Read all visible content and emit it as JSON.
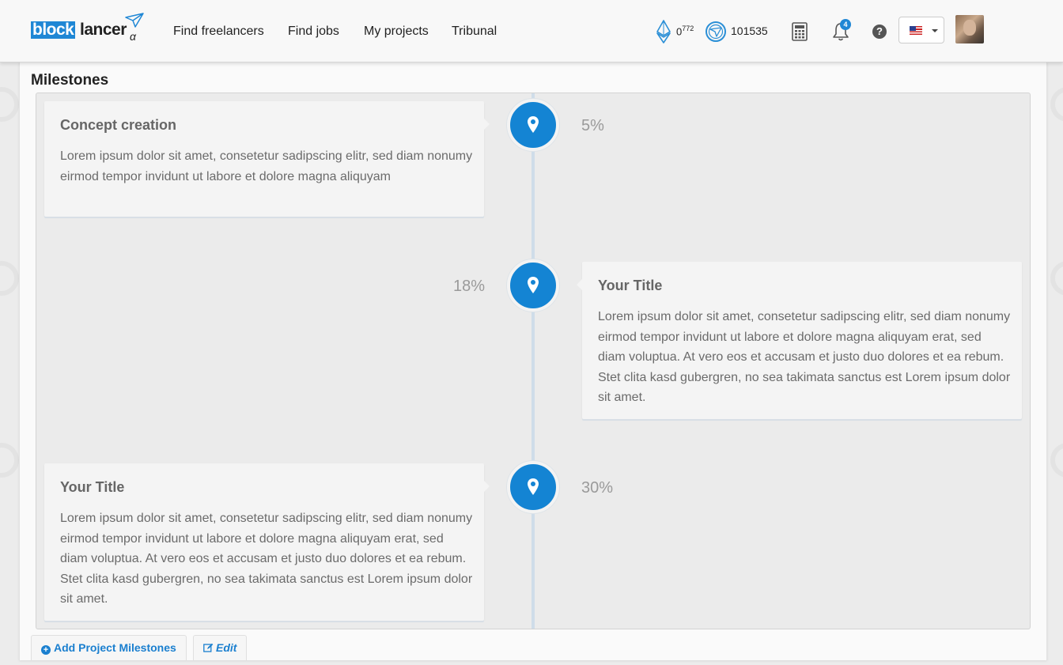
{
  "brand": {
    "name_block": "block",
    "name_lancer": "lancer",
    "suffix": "α",
    "accent_color": "#1f87d5"
  },
  "nav": {
    "links": [
      "Find freelancers",
      "Find jobs",
      "My projects",
      "Tribunal"
    ]
  },
  "wallet": {
    "eth_icon": "ethereum-icon",
    "eth_balance": "0",
    "eth_exponent": "772",
    "token_icon": "blocklancer-token-icon",
    "token_balance": "101535"
  },
  "toolbar": {
    "calculator_icon": "calculator-icon",
    "notifications_icon": "bell-icon",
    "notification_count": "4",
    "help_glyph": "?",
    "language": "en-US"
  },
  "page": {
    "section_title": "Milestones"
  },
  "milestones": [
    {
      "title": "Concept creation",
      "text": "Lorem ipsum dolor sit amet, consetetur sadipscing elitr, sed diam nonumy eirmod tempor invidunt ut labore et dolore magna aliquyam",
      "percent": "5%",
      "side": "left"
    },
    {
      "title": "Your Title",
      "text": "Lorem ipsum dolor sit amet, consetetur sadipscing elitr, sed diam nonumy eirmod tempor invidunt ut labore et dolore magna aliquyam erat, sed diam voluptua. At vero eos et accusam et justo duo dolores et ea rebum. Stet clita kasd gubergren, no sea takimata sanctus est Lorem ipsum dolor sit amet.",
      "percent": "18%",
      "side": "right"
    },
    {
      "title": "Your Title",
      "text": "Lorem ipsum dolor sit amet, consetetur sadipscing elitr, sed diam nonumy eirmod tempor invidunt ut labore et dolore magna aliquyam erat, sed diam voluptua. At vero eos et accusam et justo duo dolores et ea rebum. Stet clita kasd gubergren, no sea takimata sanctus est Lorem ipsum dolor sit amet.",
      "percent": "30%",
      "side": "left"
    }
  ],
  "actions": {
    "add_label": "Add Project Milestones",
    "add_glyph": "+",
    "edit_label": "Edit"
  },
  "colors": {
    "pin": "#1484d3",
    "timeline_line": "#cfdde9",
    "link": "#1a7fcf"
  }
}
